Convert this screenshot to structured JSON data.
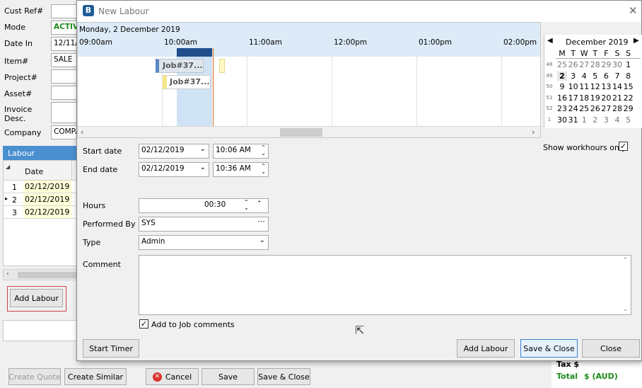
{
  "bg_form": {
    "labels": {
      "cust_ref": "Cust Ref#",
      "mode": "Mode",
      "date_in": "Date In",
      "item": "Item#",
      "project": "Project#",
      "asset": "Asset#",
      "invoice_desc": "Invoice Desc.",
      "company": "Company"
    },
    "values": {
      "mode": "ACTIV",
      "date_in": "12/11/",
      "item": "SALE",
      "company": "COMPA"
    },
    "labour_header": "Labour",
    "grid_col_date": "Date",
    "rows": [
      {
        "num": "1",
        "date": "02/12/2019"
      },
      {
        "num": "2",
        "date": "02/12/2019"
      },
      {
        "num": "3",
        "date": "02/12/2019"
      }
    ],
    "add_labour": "Add Labour",
    "create_quote": "Create Quote",
    "create_similar": "Create Similar",
    "cancel": "Cancel",
    "save": "Save",
    "save_close": "Save & Close",
    "tax": "Tax $",
    "total_label": "Total",
    "total_value": "$ (AUD)"
  },
  "dialog": {
    "title": "New Labour",
    "scheduler": {
      "date": "Monday, 2 December 2019",
      "times": [
        "09:00am",
        "10:00am",
        "11:00am",
        "12:00pm",
        "01:00pm",
        "02:00pm"
      ],
      "job1": "Job#37...",
      "job2": "Job#37..."
    },
    "calendar": {
      "month": "December 2019",
      "dow": [
        "M",
        "T",
        "W",
        "T",
        "F",
        "S",
        "S"
      ],
      "weeks": [
        {
          "wk": "48",
          "days": [
            "25",
            "26",
            "27",
            "28",
            "29",
            "30",
            "1"
          ]
        },
        {
          "wk": "49",
          "days": [
            "2",
            "3",
            "4",
            "5",
            "6",
            "7",
            "8"
          ]
        },
        {
          "wk": "50",
          "days": [
            "9",
            "10",
            "11",
            "12",
            "13",
            "14",
            "15"
          ]
        },
        {
          "wk": "51",
          "days": [
            "16",
            "17",
            "18",
            "19",
            "20",
            "21",
            "22"
          ]
        },
        {
          "wk": "52",
          "days": [
            "23",
            "24",
            "25",
            "26",
            "27",
            "28",
            "29"
          ]
        },
        {
          "wk": "1",
          "days": [
            "30",
            "31",
            "1",
            "2",
            "3",
            "4",
            "5"
          ]
        }
      ]
    },
    "show_workhours": "Show workhours only",
    "start_date_label": "Start date",
    "start_date": "02/12/2019",
    "start_time": "10:06 AM",
    "end_date_label": "End date",
    "end_date": "02/12/2019",
    "end_time": "10:36 AM",
    "hours_label": "Hours",
    "hours": "00:30",
    "performed_by_label": "Performed By",
    "performed_by": "SYS",
    "type_label": "Type",
    "type": "Admin",
    "comment_label": "Comment",
    "add_to_job_comments": "Add to Job comments",
    "start_timer": "Start Timer",
    "add_labour": "Add Labour",
    "save_close": "Save & Close",
    "close": "Close"
  }
}
